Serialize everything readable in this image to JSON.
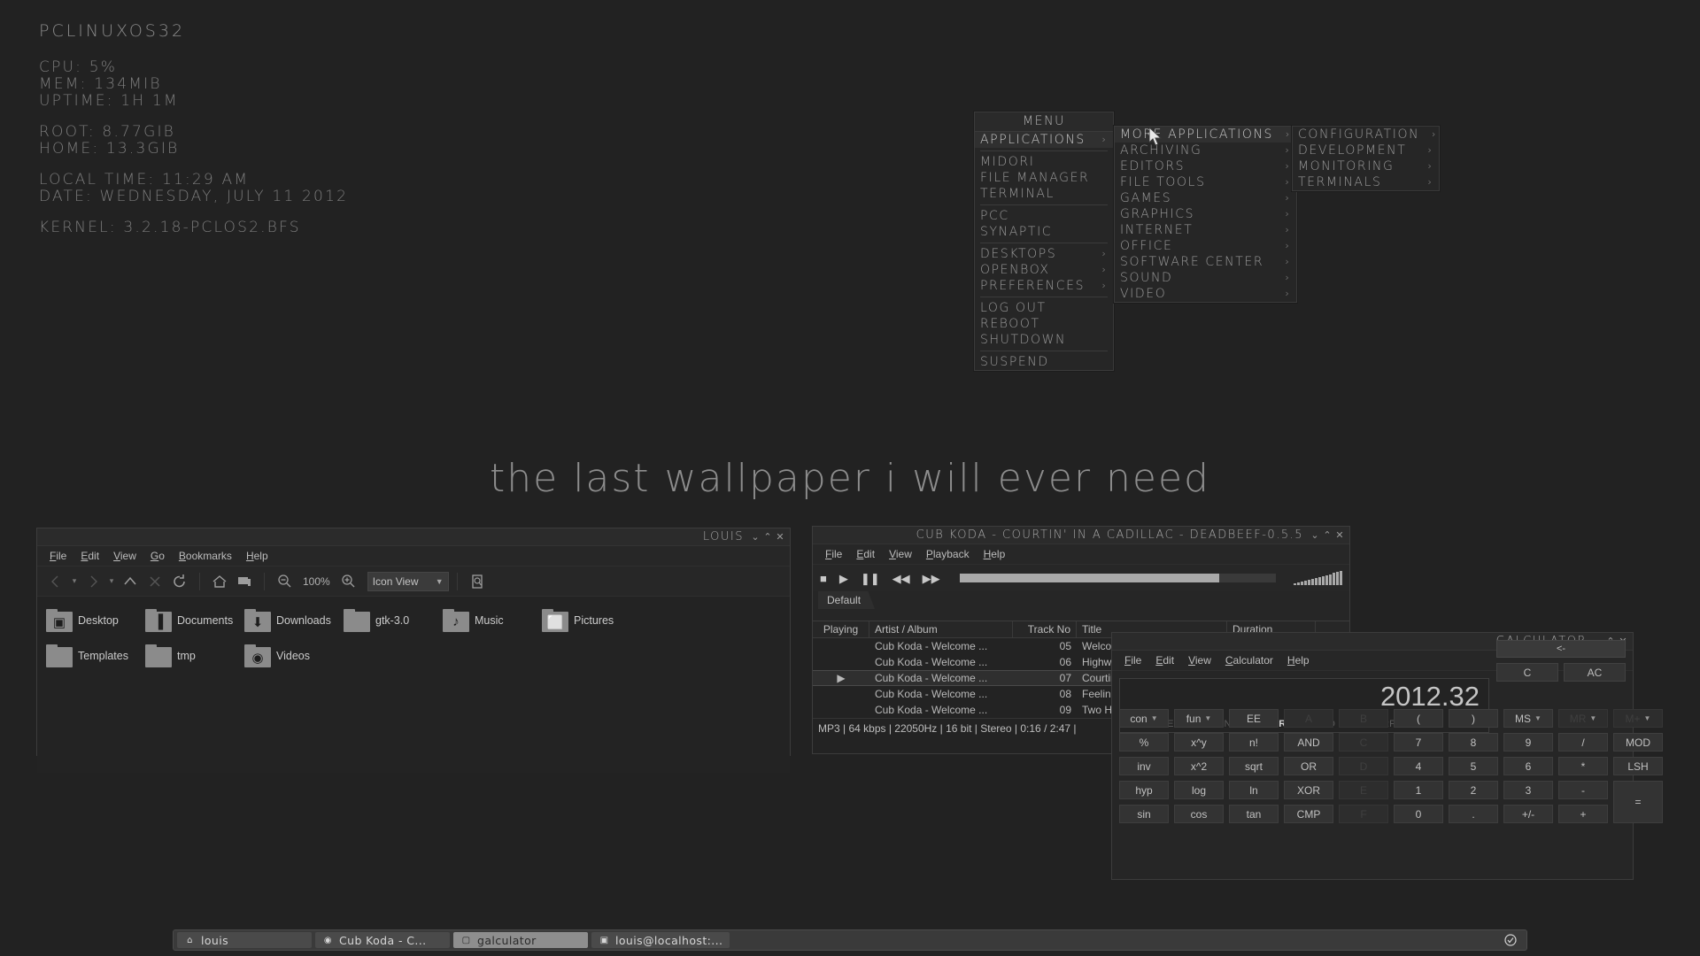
{
  "desktop": {
    "wallpaper_text": "the last wallpaper i will ever need",
    "background_color": "#222222"
  },
  "conky": {
    "hostname": "PCLinuxOS32",
    "cpu": "CPU: 5%",
    "mem": "MEM: 134MiB",
    "uptime": "Uptime: 1h 1m",
    "root": "Root: 8.77GiB",
    "home": "Home: 13.3GiB",
    "local_time": "Local Time: 11:29 am",
    "date": "Date: Wednesday, July 11 2012",
    "kernel": "Kernel: 3.2.18-PCLOS2.BFS"
  },
  "root_menu": {
    "title": "menu",
    "items": [
      {
        "label": "Applications",
        "submenu": true,
        "highlight": true
      },
      {
        "sep": true
      },
      {
        "label": "Midori",
        "submenu": false
      },
      {
        "label": "File Manager",
        "submenu": false
      },
      {
        "label": "Terminal",
        "submenu": false
      },
      {
        "sep": true
      },
      {
        "label": "PCC",
        "submenu": false
      },
      {
        "label": "Synaptic",
        "submenu": false
      },
      {
        "sep": true
      },
      {
        "label": "Desktops",
        "submenu": true
      },
      {
        "label": "Openbox",
        "submenu": true
      },
      {
        "label": "Preferences",
        "submenu": true
      },
      {
        "sep": true
      },
      {
        "label": "Log Out",
        "submenu": false
      },
      {
        "label": "Reboot",
        "submenu": false
      },
      {
        "label": "Shutdown",
        "submenu": false
      },
      {
        "sep": true
      },
      {
        "label": "Suspend",
        "submenu": false
      }
    ]
  },
  "applications_menu": {
    "items": [
      {
        "label": "More Applications",
        "submenu": true,
        "highlight": true
      },
      {
        "label": "Archiving",
        "submenu": true
      },
      {
        "label": "Editors",
        "submenu": true
      },
      {
        "label": "File Tools",
        "submenu": true
      },
      {
        "label": "Games",
        "submenu": true
      },
      {
        "label": "Graphics",
        "submenu": true
      },
      {
        "label": "Internet",
        "submenu": true
      },
      {
        "label": "Office",
        "submenu": true
      },
      {
        "label": "Software Center",
        "submenu": true
      },
      {
        "label": "Sound",
        "submenu": true
      },
      {
        "label": "Video",
        "submenu": true
      }
    ]
  },
  "more_applications_menu": {
    "items": [
      {
        "label": "Configuration",
        "submenu": true
      },
      {
        "label": "Development",
        "submenu": true
      },
      {
        "label": "Monitoring",
        "submenu": true
      },
      {
        "label": "Terminals",
        "submenu": true
      }
    ]
  },
  "file_manager": {
    "title": "louis",
    "menus": [
      "File",
      "Edit",
      "View",
      "Go",
      "Bookmarks",
      "Help"
    ],
    "zoom_level": "100%",
    "view_mode": "Icon View",
    "window_buttons": [
      "minimize",
      "maximize",
      "close"
    ],
    "items": [
      {
        "label": "Desktop",
        "icon": "desktop-folder-icon"
      },
      {
        "label": "Documents",
        "icon": "documents-folder-icon"
      },
      {
        "label": "Downloads",
        "icon": "downloads-folder-icon"
      },
      {
        "label": "gtk-3.0",
        "icon": "folder-icon"
      },
      {
        "label": "Music",
        "icon": "music-folder-icon"
      },
      {
        "label": "Pictures",
        "icon": "pictures-folder-icon"
      },
      {
        "label": "Templates",
        "icon": "folder-icon"
      },
      {
        "label": "tmp",
        "icon": "folder-icon"
      },
      {
        "label": "Videos",
        "icon": "videos-folder-icon"
      }
    ]
  },
  "player": {
    "title": "Cub Koda - Courtin' In A Cadillac - DeaDBeeF-0.5.5",
    "menus": [
      "File",
      "Edit",
      "View",
      "Playback",
      "Help"
    ],
    "transport": [
      "stop",
      "play",
      "pause",
      "previous",
      "next"
    ],
    "seek_percent": 82,
    "tab": "Default",
    "columns": [
      "Playing",
      "Artist / Album",
      "Track No",
      "Title",
      "Duration"
    ],
    "rows": [
      {
        "playing": "",
        "artist": "Cub Koda - Welcome ...",
        "track": "05",
        "title": "Welcom",
        "duration": ""
      },
      {
        "playing": "",
        "artist": "Cub Koda - Welcome ...",
        "track": "06",
        "title": "Highwa",
        "duration": ""
      },
      {
        "playing": "play",
        "artist": "Cub Koda - Welcome ...",
        "track": "07",
        "title": "Courtin",
        "duration": ""
      },
      {
        "playing": "",
        "artist": "Cub Koda - Welcome ...",
        "track": "08",
        "title": "Feelin' ",
        "duration": ""
      },
      {
        "playing": "",
        "artist": "Cub Koda - Welcome ...",
        "track": "09",
        "title": "Two Ha",
        "duration": ""
      }
    ],
    "status": "MP3 |  64 kbps | 22050Hz | 16 bit | Stereo | 0:16 / 2:47 |"
  },
  "calculator": {
    "title": "galculator",
    "menus": [
      "File",
      "Edit",
      "View",
      "Calculator",
      "Help"
    ],
    "display_value": "2012.32",
    "modes": {
      "base": [
        {
          "label": "DEC",
          "active": true
        },
        {
          "label": "HEX",
          "active": false
        },
        {
          "label": "OCT",
          "active": false
        },
        {
          "label": "BIN",
          "active": false
        }
      ],
      "angle": [
        {
          "label": "DEG",
          "active": false
        },
        {
          "label": "RAD",
          "active": true
        },
        {
          "label": "GRAD",
          "active": false
        }
      ],
      "notation": [
        {
          "label": "ALG",
          "active": true
        },
        {
          "label": "RPN",
          "active": false
        },
        {
          "label": "FORM",
          "active": false
        }
      ]
    },
    "backspace_label": "<-",
    "clear_label": "C",
    "all_clear_label": "AC",
    "keys": [
      [
        {
          "label": "con",
          "dropdown": true
        },
        {
          "label": "fun",
          "dropdown": true
        },
        {
          "label": "EE"
        },
        {
          "label": "A",
          "disabled": true
        },
        {
          "label": "B",
          "disabled": true
        },
        {
          "label": "("
        },
        {
          "label": ")"
        },
        {
          "label": "MS",
          "dropdown": true
        },
        {
          "label": "MR",
          "dropdown": true,
          "disabled": true
        },
        {
          "label": "M+",
          "dropdown": true,
          "disabled": true
        }
      ],
      [
        {
          "label": "%"
        },
        {
          "label": "x^y"
        },
        {
          "label": "n!"
        },
        {
          "label": "AND"
        },
        {
          "label": "C",
          "disabled": true
        },
        {
          "label": "7"
        },
        {
          "label": "8"
        },
        {
          "label": "9"
        },
        {
          "label": "/"
        },
        {
          "label": "MOD"
        }
      ],
      [
        {
          "label": "inv"
        },
        {
          "label": "x^2"
        },
        {
          "label": "sqrt"
        },
        {
          "label": "OR"
        },
        {
          "label": "D",
          "disabled": true
        },
        {
          "label": "4"
        },
        {
          "label": "5"
        },
        {
          "label": "6"
        },
        {
          "label": "*"
        },
        {
          "label": "LSH"
        }
      ],
      [
        {
          "label": "hyp"
        },
        {
          "label": "log"
        },
        {
          "label": "ln"
        },
        {
          "label": "XOR"
        },
        {
          "label": "E",
          "disabled": true
        },
        {
          "label": "1"
        },
        {
          "label": "2"
        },
        {
          "label": "3"
        },
        {
          "label": "-"
        },
        {
          "label": "=",
          "tall": true
        }
      ],
      [
        {
          "label": "sin"
        },
        {
          "label": "cos"
        },
        {
          "label": "tan"
        },
        {
          "label": "CMP"
        },
        {
          "label": "F",
          "disabled": true
        },
        {
          "label": "0"
        },
        {
          "label": "."
        },
        {
          "label": "+/-"
        },
        {
          "label": "+"
        }
      ]
    ]
  },
  "taskbar": {
    "tasks": [
      {
        "label": "louis",
        "icon": "home-icon",
        "active": false
      },
      {
        "label": "Cub Koda - C...",
        "icon": "play-circle-icon",
        "active": false
      },
      {
        "label": "galculator",
        "icon": "window-icon",
        "active": true
      },
      {
        "label": "louis@localhost:...",
        "icon": "terminal-icon",
        "active": false
      }
    ],
    "tray_icon": "check-circle-icon"
  }
}
